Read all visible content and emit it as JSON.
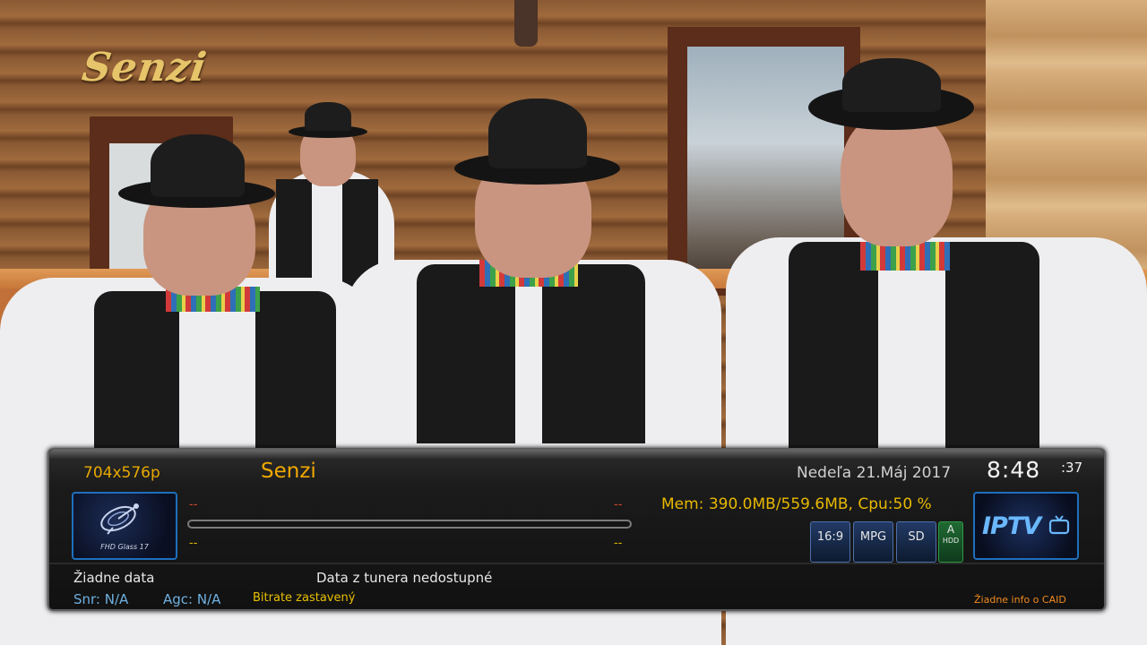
{
  "video": {
    "overlay_logo": "Senzi"
  },
  "infobar": {
    "resolution": "704x576p",
    "channel_name": "Senzi",
    "date": "Nedeľa  21.Máj 2017",
    "clock": {
      "hours_minutes": "8:48",
      "seconds": ":37"
    },
    "picon_caption": "FHD Glass 17",
    "current_event": {
      "left": "--",
      "right": "--"
    },
    "next_event": {
      "left": "--",
      "right": "--"
    },
    "progress_fraction": 0.0,
    "memory_cpu": "Mem: 390.0MB/559.6MB, Cpu:50 %",
    "badges": {
      "aspect": "16:9",
      "codec": "MPG",
      "definition": "SD",
      "audio": "A",
      "storage": "HDD"
    },
    "provider_logo": "IPTV",
    "signal_info": "Žiadne data",
    "tuner_info": "Data z tunera nedostupné",
    "snr": "Snr: N/A",
    "agc": "Agc: N/A",
    "bitrate": "Bitrate zastavený",
    "caid_info": "Žiadne info o CAID",
    "colors": {
      "accent_orange": "#f0a800",
      "accent_blue": "#1e6fbd",
      "caid_orange": "#f08a20",
      "snr_blue": "#6fb0e0"
    },
    "icons": {
      "picon": "satellite-dish-icon",
      "provider": "tv-icon"
    }
  }
}
